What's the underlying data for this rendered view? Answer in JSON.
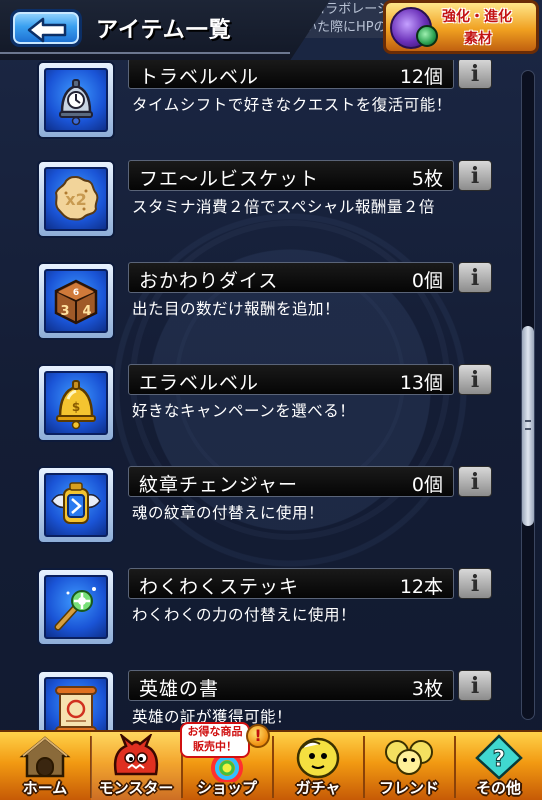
{
  "header": {
    "back_icon": "back-arrow-icon",
    "title": "アイテム一覧",
    "ticker": {
      "line1": "Sコラボレーション専用ステッ",
      "line2": "いた際にHPのみ回"
    },
    "evolution_button": {
      "line1": "強化・進化",
      "line2": "素材"
    }
  },
  "items": [
    {
      "name": "トラベルベル",
      "count": "12個",
      "desc": "タイムシフトで好きなクエストを復活可能！",
      "icon": "bell-clock-icon"
    },
    {
      "name": "フエ〜ルビスケット",
      "count": "5枚",
      "desc": "スタミナ消費２倍でスペシャル報酬量２倍",
      "icon": "biscuit-icon"
    },
    {
      "name": "おかわりダイス",
      "count": "0個",
      "desc": "出た目の数だけ報酬を追加！",
      "icon": "dice-icon"
    },
    {
      "name": "エラベルベル",
      "count": "13個",
      "desc": "好きなキャンペーンを選べる！",
      "icon": "gold-bell-icon"
    },
    {
      "name": "紋章チェンジャー",
      "count": "0個",
      "desc": "魂の紋章の付替えに使用！",
      "icon": "emblem-changer-icon"
    },
    {
      "name": "わくわくステッキ",
      "count": "12本",
      "desc": "わくわくの力の付替えに使用！",
      "icon": "magic-wand-icon"
    },
    {
      "name": "英雄の書",
      "count": "3枚",
      "desc": "英雄の証が獲得可能！",
      "icon": "scroll-icon"
    }
  ],
  "info_button_glyph": "i",
  "scrollbar": {
    "position": 0.55
  },
  "bottom_nav": {
    "shop_badge": {
      "line1": "お得な商品",
      "line2": "販売中！"
    },
    "shop_alert": "!",
    "items": [
      {
        "label": "ホーム",
        "icon": "home-icon"
      },
      {
        "label": "モンスター",
        "icon": "monster-icon"
      },
      {
        "label": "ショップ",
        "icon": "shop-icon"
      },
      {
        "label": "ガチャ",
        "icon": "gacha-icon"
      },
      {
        "label": "フレンド",
        "icon": "friend-icon"
      },
      {
        "label": "その他",
        "icon": "other-icon"
      }
    ]
  },
  "colors": {
    "background": "#15203a",
    "icon_frame_blue": "#1a54d6",
    "nav_orange": "#f29a12",
    "back_button_blue": "#3aa0f0"
  }
}
